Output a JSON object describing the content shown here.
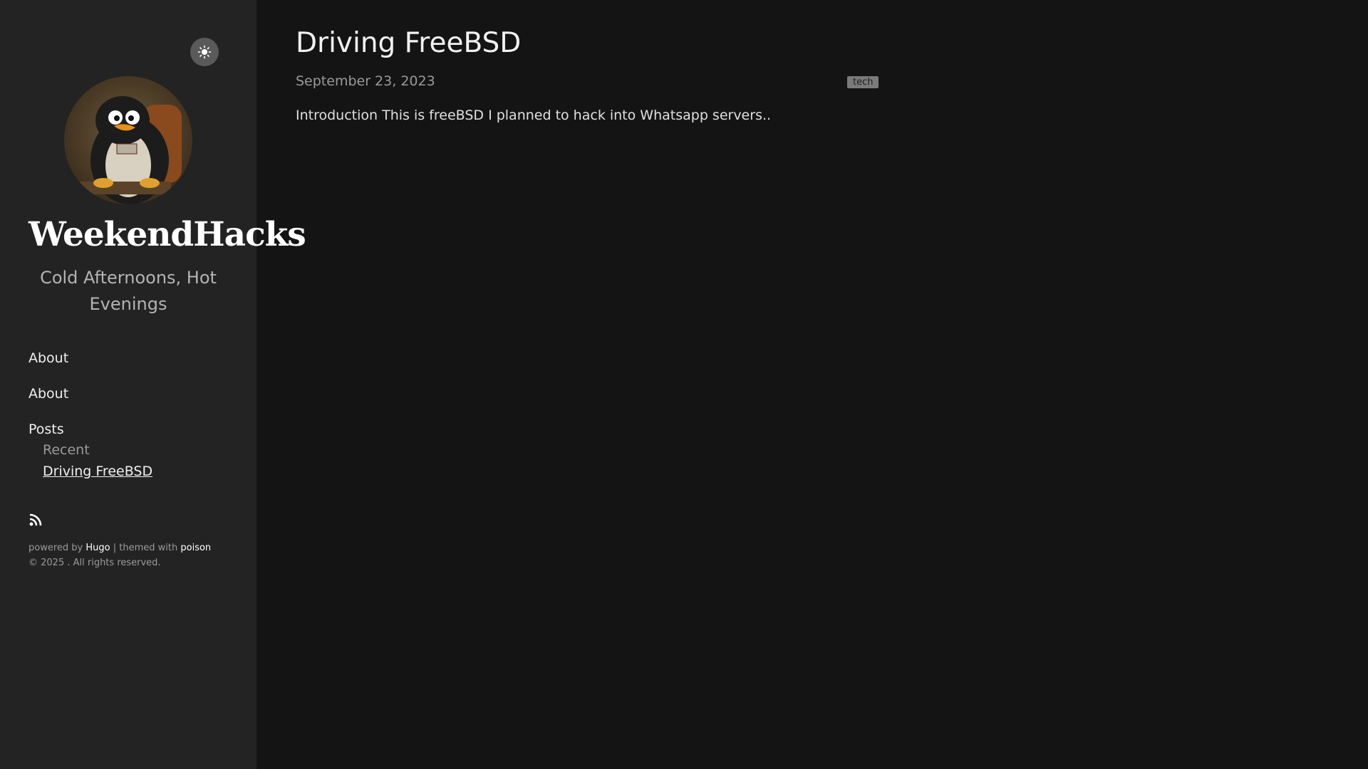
{
  "sidebar": {
    "theme_toggle_icon": "sun-icon",
    "avatar_alt": "penguin-avatar",
    "site_title": "WeekendHacks",
    "tagline": "Cold Afternoons, Hot Evenings",
    "nav": {
      "items": [
        {
          "label": "About"
        },
        {
          "label": "About"
        }
      ],
      "group": {
        "label": "Posts",
        "sub_label": "Recent",
        "links": [
          {
            "label": "Driving FreeBSD"
          }
        ]
      }
    },
    "rss_icon": "rss-icon",
    "footer": {
      "powered_prefix": "powered by",
      "hugo": "Hugo",
      "separator": "| themed with",
      "theme": "poison",
      "copyright": "© 2025 . All rights reserved."
    }
  },
  "post": {
    "title": "Driving FreeBSD",
    "date": "September 23, 2023",
    "tag": "tech",
    "summary": "Introduction This is freeBSD I planned to hack into Whatsapp servers.."
  },
  "colors": {
    "sidebar_bg": "#232323",
    "main_bg": "#141414",
    "toggle_bg": "#5a5a5a",
    "tag_bg": "#7a7a7a"
  }
}
